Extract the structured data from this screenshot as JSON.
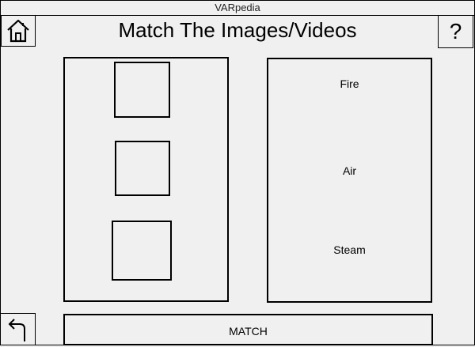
{
  "window": {
    "title": "VARpedia"
  },
  "header": {
    "home_icon": "home-icon",
    "title": "Match The Images/Videos",
    "help_label": "?"
  },
  "match_panel": {
    "image_slots": 3,
    "words": [
      "Fire",
      "Air",
      "Steam"
    ]
  },
  "footer": {
    "back_icon": "back-arrow-icon",
    "match_label": "MATCH"
  }
}
